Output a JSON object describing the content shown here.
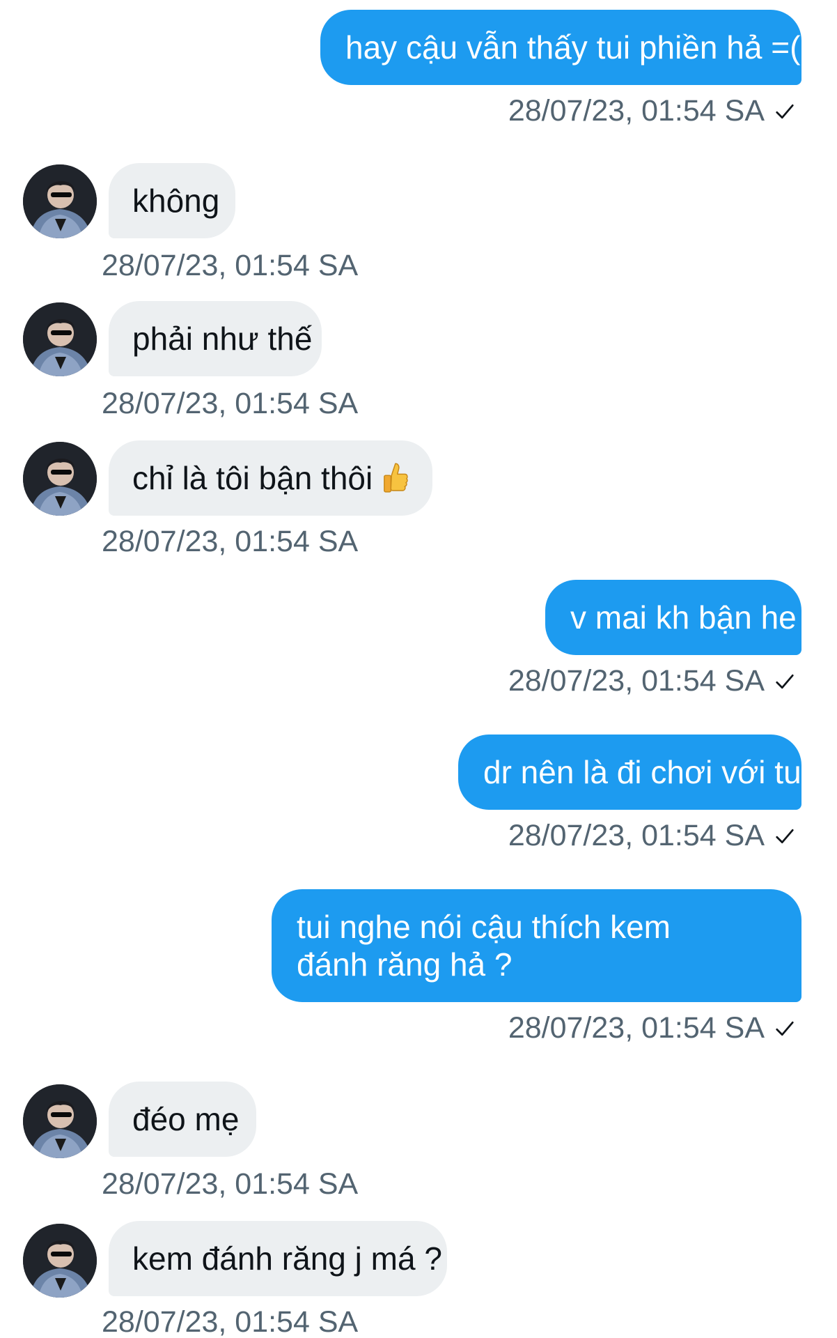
{
  "conversation": {
    "messages": [
      {
        "direction": "sent",
        "text": "hay cậu vẫn thấy tui phiền hả =((",
        "time": "28/07/23, 01:54 SA",
        "read": true
      },
      {
        "direction": "received",
        "text": "không",
        "time": "28/07/23, 01:54 SA"
      },
      {
        "direction": "received",
        "text": "phải như thế",
        "time": "28/07/23, 01:54 SA"
      },
      {
        "direction": "received",
        "text": "chỉ là tôi bận thôi",
        "emoji": "thumbs-up",
        "time": "28/07/23, 01:54 SA"
      },
      {
        "direction": "sent",
        "text": "v mai kh bận he",
        "time": "28/07/23, 01:54 SA",
        "read": true
      },
      {
        "direction": "sent",
        "text": "dr nên là đi chơi với tui",
        "time": "28/07/23, 01:54 SA",
        "read": true
      },
      {
        "direction": "sent",
        "text": "tui nghe nói cậu thích kem đánh răng hả ?",
        "time": "28/07/23, 01:54 SA",
        "read": true
      },
      {
        "direction": "received",
        "text": "đéo mẹ",
        "time": "28/07/23, 01:54 SA"
      },
      {
        "direction": "received",
        "text": "kem đánh răng j má ?",
        "time": "28/07/23, 01:54 SA"
      }
    ]
  },
  "colors": {
    "sent_bubble": "#1d9bf0",
    "received_bubble": "#eceff1",
    "timestamp": "#536471",
    "received_text": "#0f1419"
  },
  "icons": {
    "read_receipt": "checkmark-icon",
    "avatar": "user-avatar",
    "emoji": "thumbs-up-icon"
  }
}
